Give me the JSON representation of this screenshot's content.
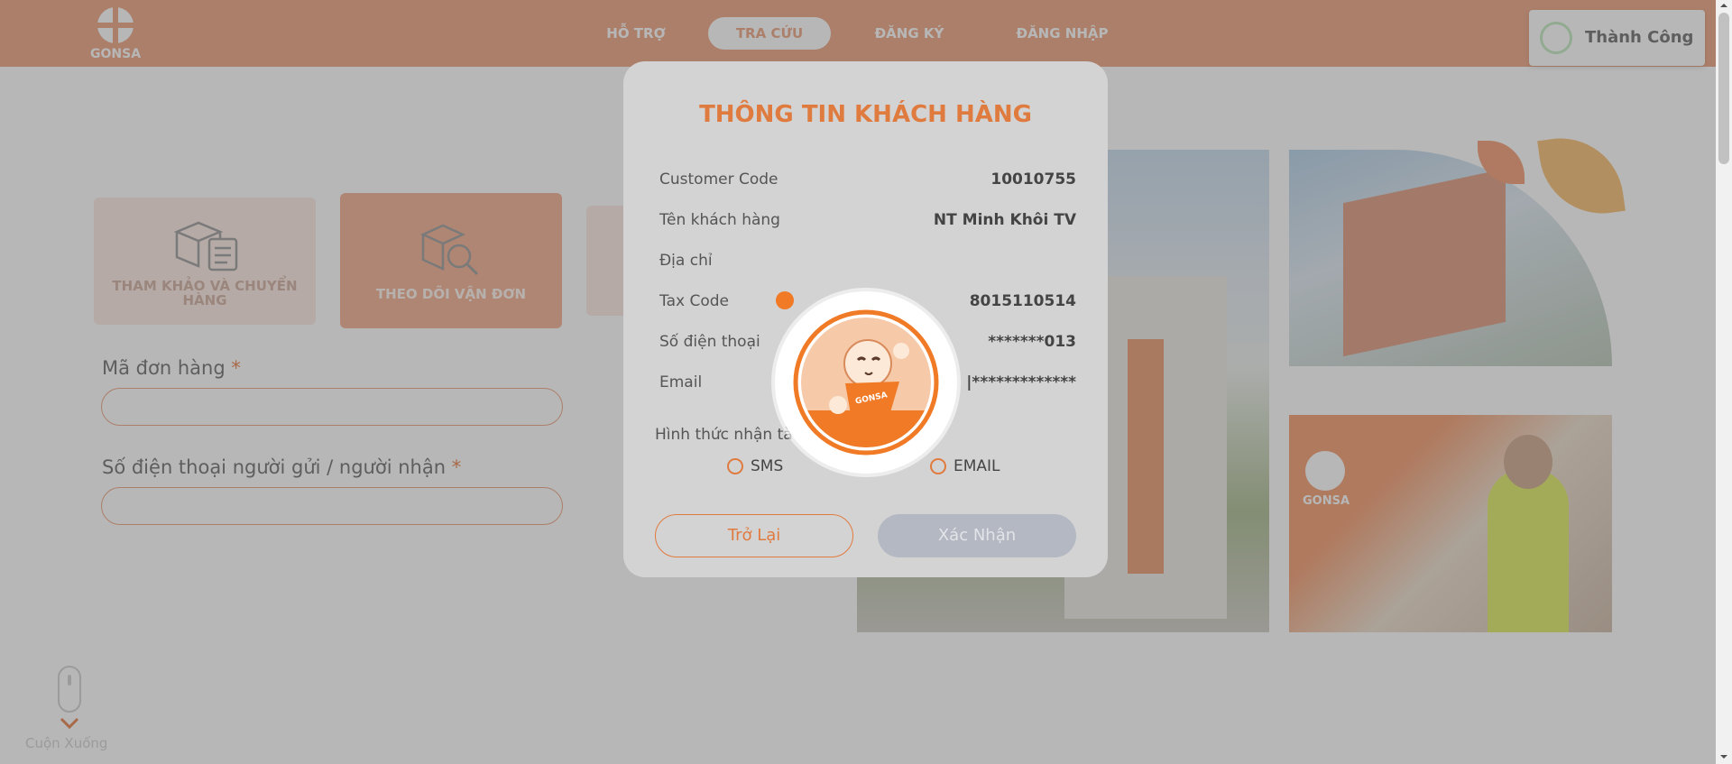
{
  "header": {
    "logo_text": "GONSA",
    "nav": [
      {
        "label": "HỖ TRỢ"
      },
      {
        "label": "TRA CỨU"
      },
      {
        "label": "ĐĂNG KÝ"
      },
      {
        "label": "ĐĂNG NHẬP"
      }
    ],
    "active_nav": "TRA CỨU"
  },
  "toast": {
    "text": "Thành Công"
  },
  "tiles": [
    {
      "label": "THAM KHẢO VÀ CHUYỂN HÀNG",
      "icon": "boxes-clipboard-icon"
    },
    {
      "label": "THEO DÕI VẬN ĐƠN",
      "icon": "box-magnifier-icon"
    }
  ],
  "form": {
    "order_code_label": "Mã đơn hàng",
    "phone_label": "Số điện thoại người gửi / người nhận",
    "required_mark": "*"
  },
  "scroll_hint": "Cuộn Xuống",
  "photo_logo_text": "GONSA",
  "modal": {
    "title": "THÔNG TIN KHÁCH HÀNG",
    "rows": [
      {
        "label": "Customer Code",
        "value": "10010755"
      },
      {
        "label": "Tên khách hàng",
        "value": "NT Minh Khôi TV"
      },
      {
        "label": "Địa chỉ",
        "value": ""
      },
      {
        "label": "Tax Code",
        "value": "8015110514"
      },
      {
        "label": "Số điện thoại",
        "value": "*******013"
      },
      {
        "label": "Email",
        "value": "|*************"
      }
    ],
    "receive_label": "Hình thức nhận tà",
    "options": [
      {
        "label": "SMS",
        "checked": false
      },
      {
        "label": "EMAIL",
        "checked": false
      }
    ],
    "back_button": "Trở Lại",
    "confirm_button": "Xác Nhận"
  },
  "loader": {
    "mascot_text": "GONSA",
    "icon": "mascot-loading-icon"
  },
  "colors": {
    "brand_orange": "#e9956c",
    "accent_orange": "#e07b3f",
    "toast_ring": "#b9e6b5"
  }
}
